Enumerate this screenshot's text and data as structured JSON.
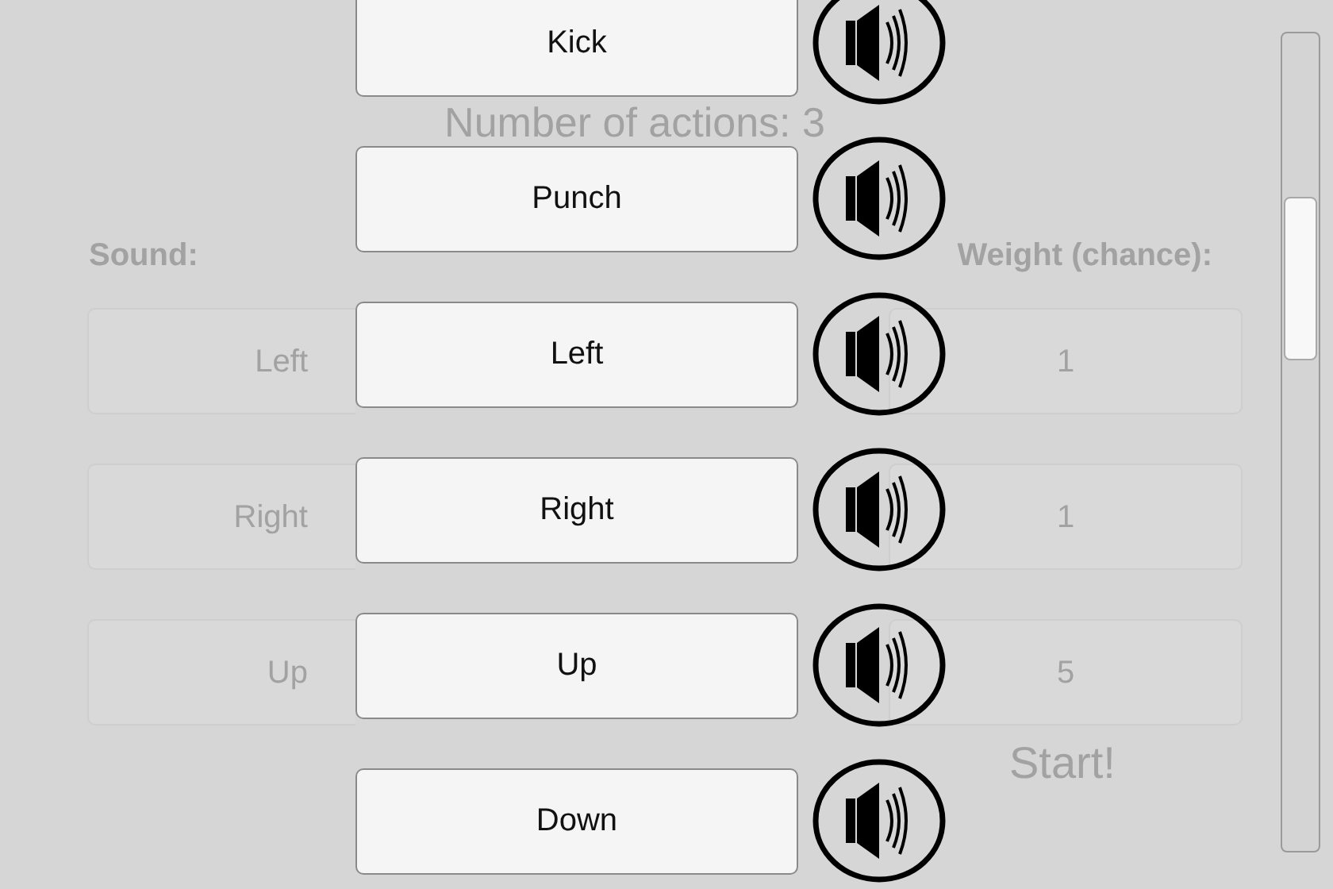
{
  "background": {
    "title": "Number of actions: 3",
    "sound_header": "Sound:",
    "weight_header": "Weight (chance):",
    "rows": [
      {
        "sound": "Left",
        "weight": "1"
      },
      {
        "sound": "Right",
        "weight": "1"
      },
      {
        "sound": "Up",
        "weight": "5"
      }
    ],
    "start": "Start!"
  },
  "dropdown": {
    "options": [
      {
        "label": "Kick"
      },
      {
        "label": "Punch"
      },
      {
        "label": "Left"
      },
      {
        "label": "Right"
      },
      {
        "label": "Up"
      },
      {
        "label": "Down"
      }
    ]
  }
}
